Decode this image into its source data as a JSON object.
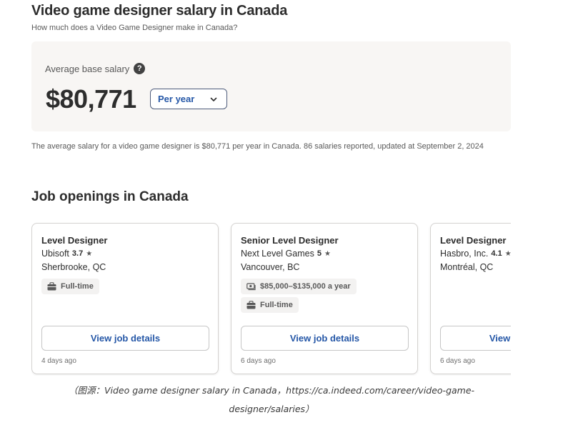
{
  "header": {
    "title": "Video game designer salary in Canada",
    "subtitle": "How much does a Video Game Designer make in Canada?"
  },
  "salary": {
    "label": "Average base salary",
    "help_icon": "?",
    "amount": "$80,771",
    "period": "Per year",
    "note": "The average salary for a video game designer is $80,771 per year in Canada.  86 salaries reported, updated at September 2, 2024"
  },
  "jobs": {
    "section_title": "Job openings in Canada",
    "cards": [
      {
        "title": "Level Designer",
        "company": "Ubisoft",
        "rating": "3.7",
        "location": "Sherbrooke, QC",
        "pay": "",
        "job_type": "Full-time",
        "button": "View job details",
        "posted": "4 days ago"
      },
      {
        "title": "Senior Level Designer",
        "company": "Next Level Games",
        "rating": "5",
        "location": "Vancouver, BC",
        "pay": "$85,000–$135,000 a year",
        "job_type": "Full-time",
        "button": "View job details",
        "posted": "6 days ago"
      },
      {
        "title": "Level Designer",
        "company": "Hasbro, Inc.",
        "rating": "4.1",
        "location": "Montréal, QC",
        "pay": "",
        "job_type": "",
        "button": "View job details",
        "posted": "6 days ago"
      }
    ]
  },
  "caption": {
    "line1": "（图源：Video game designer salary in Canada，https://ca.indeed.com/career/video-game-",
    "line2": "designer/salaries）"
  },
  "colors": {
    "accent": "#2557a7",
    "panel_bg": "#f8f6f4",
    "text": "#2d2d2d"
  }
}
